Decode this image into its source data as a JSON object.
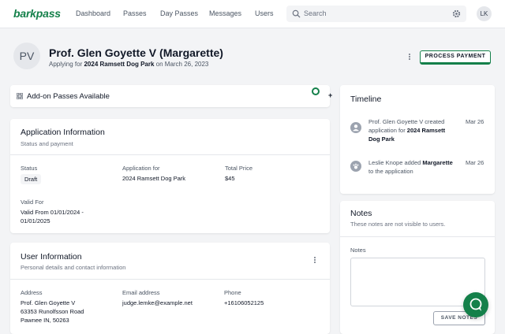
{
  "brand": {
    "name": "barkpass",
    "accent": "#14804a"
  },
  "nav": {
    "links": [
      "Dashboard",
      "Passes",
      "Day Passes",
      "Messages",
      "Users"
    ],
    "search_placeholder": "Search",
    "user_initials": "LK"
  },
  "header": {
    "avatar_initials": "PV",
    "name": "Prof. Glen Goyette V (Margarette)",
    "applying_prefix": "Applying for",
    "park": "2024 Ramsett Dog Park",
    "date_text": "on March 26, 2023",
    "process_button": "PROCESS PAYMENT"
  },
  "addon": {
    "label": "Add-on Passes Available",
    "add_symbol": "+"
  },
  "application": {
    "title": "Application Information",
    "subtitle": "Status and payment",
    "status_label": "Status",
    "status_value": "Draft",
    "app_for_label": "Application for",
    "app_for_value": "2024 Ramsett Dog Park",
    "price_label": "Total Price",
    "price_value": "$45",
    "valid_label": "Valid For",
    "valid_line1": "Valid From 01/01/2024 -",
    "valid_line2": "01/01/2025"
  },
  "user": {
    "title": "User Information",
    "subtitle": "Personal details and contact information",
    "address_label": "Address",
    "address_lines": [
      "Prof. Glen Goyette V",
      "63353 Runolfsson Road",
      "Pawnee IN, 50263"
    ],
    "email_label": "Email address",
    "email_value": "judge.lemke@example.net",
    "phone_label": "Phone",
    "phone_value": "+16106052125"
  },
  "timeline": {
    "title": "Timeline",
    "events": [
      {
        "line1": "Prof. Glen Goyette V created",
        "line2_prefix": "application for ",
        "line2_bold": "2024 Ramsett",
        "line3": "Dog Park",
        "date": "Mar 26"
      },
      {
        "line1_prefix": "Leslie Knope added ",
        "line1_bold": "Margarette",
        "line2": "to the application",
        "date": "Mar 26"
      }
    ]
  },
  "notes": {
    "title": "Notes",
    "subtitle": "These notes are not visible to users.",
    "field_label": "Notes",
    "save_button": "SAVE NOTES"
  }
}
